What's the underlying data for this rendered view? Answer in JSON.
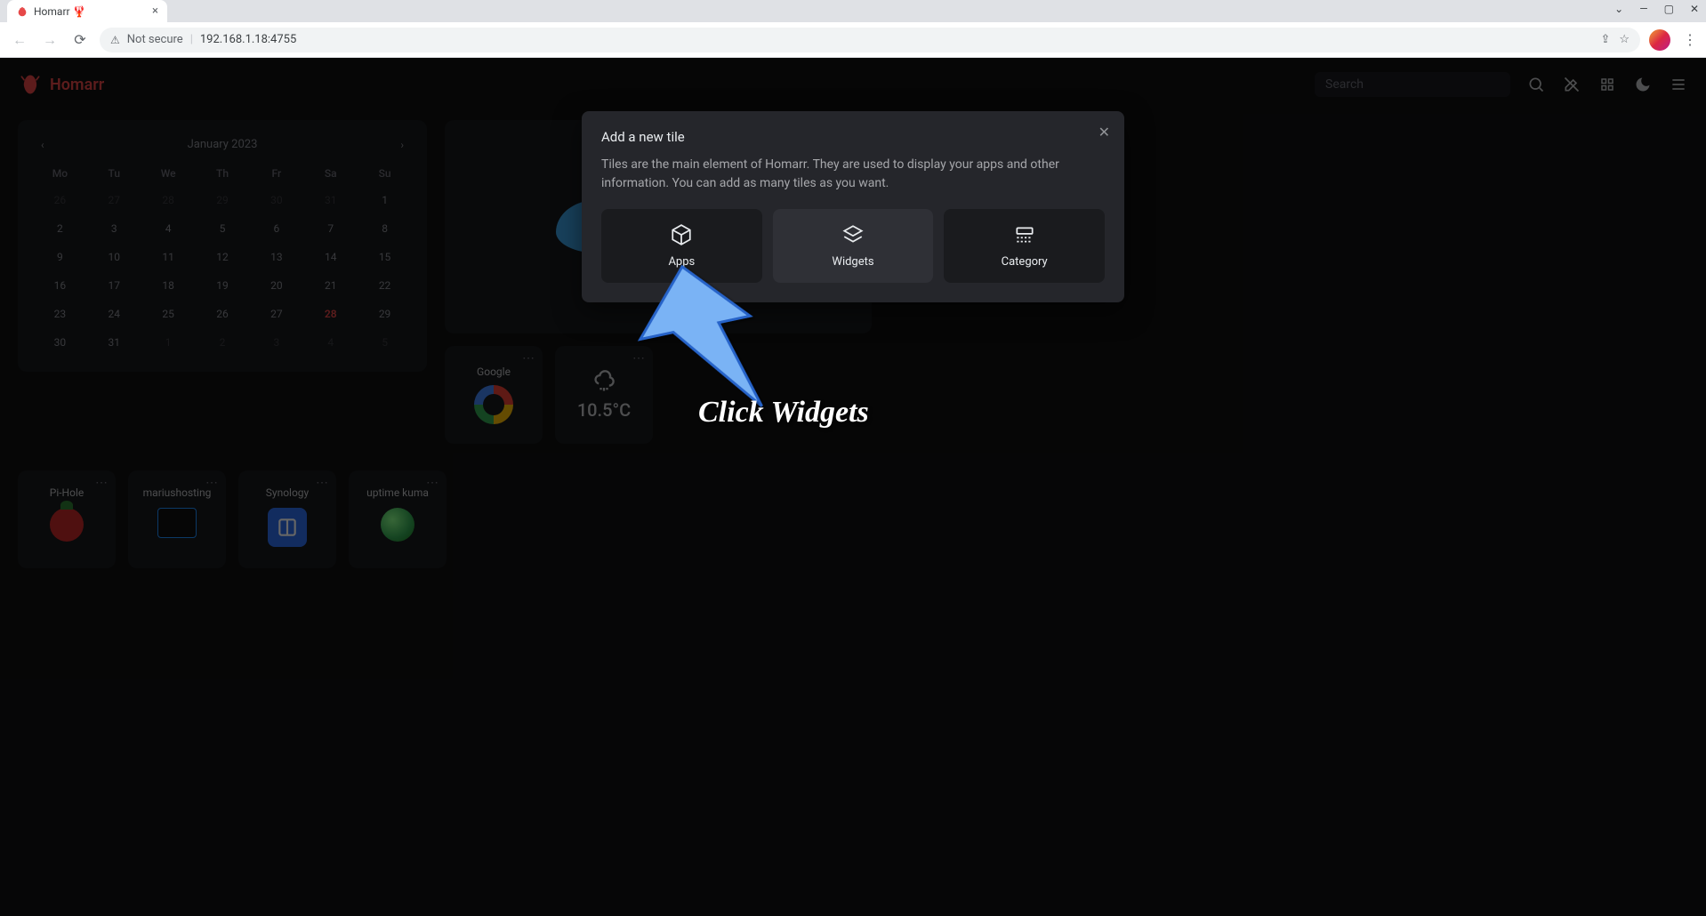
{
  "browser": {
    "tab_title": "Homarr 🦞",
    "not_secure_label": "Not secure",
    "url": "192.168.1.18:4755"
  },
  "header": {
    "app_name": "Homarr",
    "search_placeholder": "Search"
  },
  "calendar": {
    "month_label": "January 2023",
    "dow": [
      "Mo",
      "Tu",
      "We",
      "Th",
      "Fr",
      "Sa",
      "Su"
    ],
    "days": [
      {
        "n": "26",
        "muted": true
      },
      {
        "n": "27",
        "muted": true
      },
      {
        "n": "28",
        "muted": true
      },
      {
        "n": "29",
        "muted": true
      },
      {
        "n": "30",
        "muted": true
      },
      {
        "n": "31",
        "muted": true
      },
      {
        "n": "1"
      },
      {
        "n": "2"
      },
      {
        "n": "3"
      },
      {
        "n": "4"
      },
      {
        "n": "5"
      },
      {
        "n": "6"
      },
      {
        "n": "7"
      },
      {
        "n": "8"
      },
      {
        "n": "9"
      },
      {
        "n": "10"
      },
      {
        "n": "11"
      },
      {
        "n": "12"
      },
      {
        "n": "13"
      },
      {
        "n": "14"
      },
      {
        "n": "15"
      },
      {
        "n": "16"
      },
      {
        "n": "17"
      },
      {
        "n": "18"
      },
      {
        "n": "19"
      },
      {
        "n": "20"
      },
      {
        "n": "21"
      },
      {
        "n": "22"
      },
      {
        "n": "23"
      },
      {
        "n": "24"
      },
      {
        "n": "25"
      },
      {
        "n": "26"
      },
      {
        "n": "27"
      },
      {
        "n": "28",
        "today": true
      },
      {
        "n": "29"
      },
      {
        "n": "30"
      },
      {
        "n": "31"
      },
      {
        "n": "1",
        "muted": true
      },
      {
        "n": "2",
        "muted": true
      },
      {
        "n": "3",
        "muted": true
      },
      {
        "n": "4",
        "muted": true
      },
      {
        "n": "5",
        "muted": true
      }
    ]
  },
  "tiles": {
    "google_label": "Google",
    "weather_temp": "10.5°C"
  },
  "app_tiles": {
    "pihole": "Pi-Hole",
    "marius": "mariushosting",
    "synology": "Synology",
    "uptime": "uptime kuma"
  },
  "modal": {
    "title": "Add a new tile",
    "description": "Tiles are the main element of Homarr. They are used to display your apps and other information. You can add as many tiles as you want.",
    "option_apps": "Apps",
    "option_widgets": "Widgets",
    "option_category": "Category"
  },
  "annotation": {
    "text": "Click Widgets"
  }
}
